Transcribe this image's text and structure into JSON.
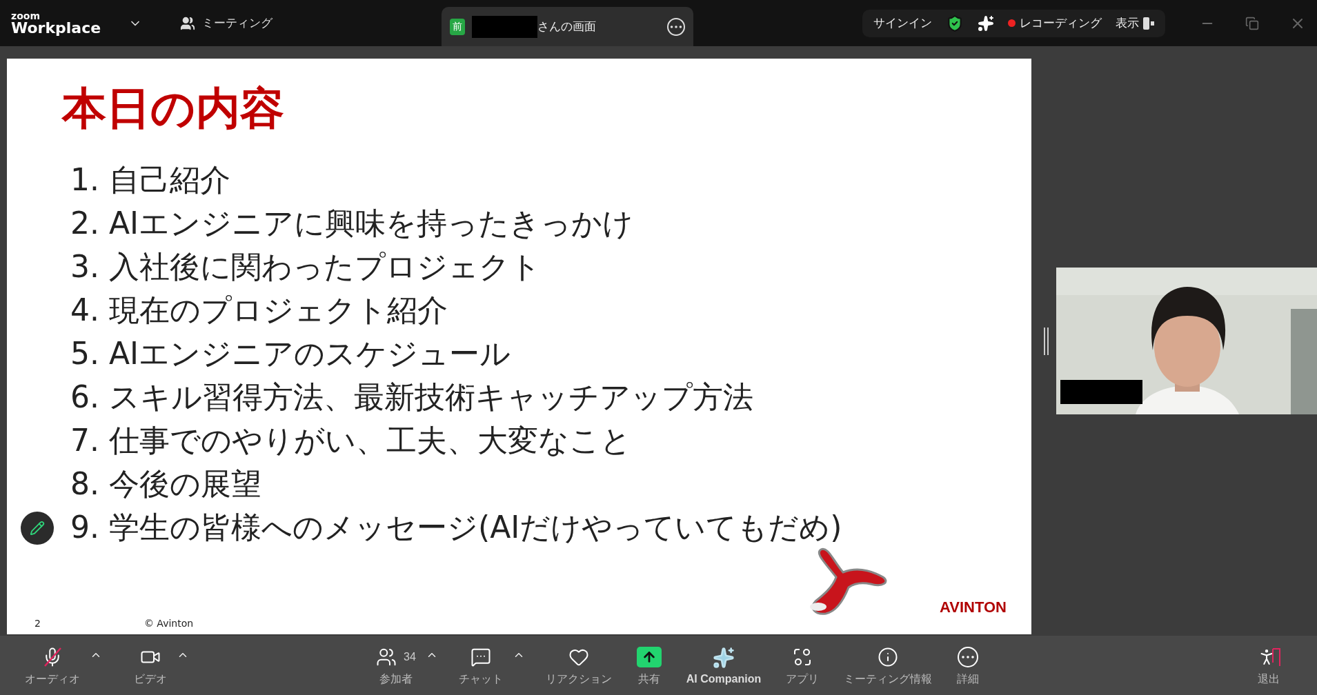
{
  "app_bar": {
    "logo_top": "zoom",
    "logo_bottom": "Workplace",
    "meeting_label": "ミーティング"
  },
  "share_tab": {
    "badge": "前",
    "title": "さんの画面"
  },
  "top_controls": {
    "signin": "サインイン",
    "recording": "レコーディング",
    "view": "表示"
  },
  "slide": {
    "title": "本日の内容",
    "items": [
      "1. 自己紹介",
      "2. AIエンジニアに興味を持ったきっかけ",
      "3. 入社後に関わったプロジェクト",
      "4. 現在のプロジェクト紹介",
      "5. AIエンジニアのスケジュール",
      "6. スキル習得方法、最新技術キャッチアップ方法",
      "7. 仕事でのやりがい、工夫、大変なこと",
      "8. 今後の展望",
      "9. 学生の皆様へのメッセージ(AIだけやっていてもだめ)"
    ],
    "page": "2",
    "copyright": "© Avinton",
    "brand": "AVINTON"
  },
  "toolbar": [
    {
      "kind": "audio",
      "label": "オーディオ",
      "muted": true,
      "menu": true
    },
    {
      "kind": "video",
      "label": "ビデオ",
      "menu": true
    },
    {
      "kind": "participants",
      "label": "参加者",
      "count": "34",
      "menu": true
    },
    {
      "kind": "chat",
      "label": "チャット",
      "menu": true
    },
    {
      "kind": "reaction",
      "label": "リアクション",
      "menu": false
    },
    {
      "kind": "share",
      "label": "共有",
      "menu": false
    },
    {
      "kind": "ai",
      "label": "AI Companion",
      "menu": false
    },
    {
      "kind": "apps",
      "label": "アプリ",
      "menu": false
    },
    {
      "kind": "info",
      "label": "ミーティング情報",
      "menu": false
    },
    {
      "kind": "more",
      "label": "詳細",
      "menu": false
    },
    {
      "kind": "leave",
      "label": "退出",
      "menu": false
    }
  ]
}
